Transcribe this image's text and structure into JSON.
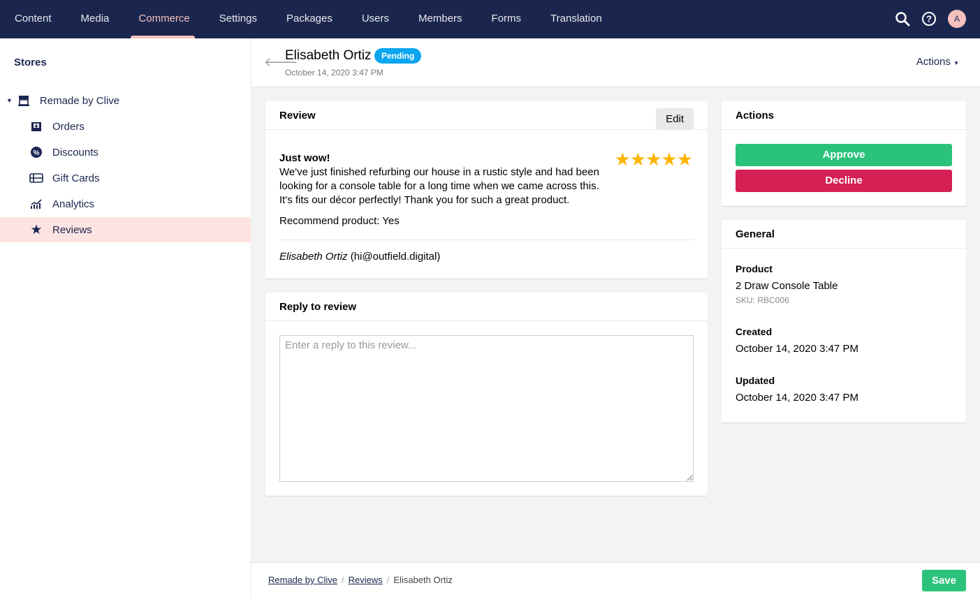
{
  "nav": {
    "items": [
      "Content",
      "Media",
      "Commerce",
      "Settings",
      "Packages",
      "Users",
      "Members",
      "Forms",
      "Translation"
    ],
    "active": "Commerce",
    "avatar": "A"
  },
  "sidebar": {
    "title": "Stores",
    "store": "Remade by Clive",
    "items": [
      {
        "label": "Orders",
        "icon": "inbox-icon"
      },
      {
        "label": "Discounts",
        "icon": "percent-badge-icon"
      },
      {
        "label": "Gift Cards",
        "icon": "gift-card-icon"
      },
      {
        "label": "Analytics",
        "icon": "chart-icon"
      },
      {
        "label": "Reviews",
        "icon": "star-icon"
      }
    ]
  },
  "header": {
    "title": "Elisabeth Ortiz",
    "status": "Pending",
    "date": "October 14, 2020 3:47 PM",
    "actions": "Actions"
  },
  "review": {
    "heading": "Review",
    "edit": "Edit",
    "title": "Just wow!",
    "body": "We've just finished refurbing our house in a rustic style and had been looking for a console table for a long time when we came across this. It's fits our décor perfectly! Thank you for such a great product.",
    "recommend": "Recommend product: Yes",
    "author": "Elisabeth Ortiz",
    "email": "(hi@outfield.digital)",
    "rating": 5,
    "stars": "★★★★★"
  },
  "reply": {
    "heading": "Reply to review",
    "placeholder": "Enter a reply to this review..."
  },
  "actions": {
    "heading": "Actions",
    "approve": "Approve",
    "decline": "Decline"
  },
  "general": {
    "heading": "General",
    "product_label": "Product",
    "product": "2 Draw Console Table",
    "sku": "SKU: RBC006",
    "created_label": "Created",
    "created": "October 14, 2020 3:47 PM",
    "updated_label": "Updated",
    "updated": "October 14, 2020 3:47 PM"
  },
  "footer": {
    "crumbs": [
      "Remade by Clive",
      "Reviews",
      "Elisabeth Ortiz"
    ],
    "sep": "/",
    "save": "Save"
  },
  "colors": {
    "nav": "#1b264f",
    "accent": "#f5c1bc",
    "approve": "#2bc37c",
    "decline": "#d42054",
    "pending": "#0ba6f0",
    "star": "#ffb400"
  }
}
